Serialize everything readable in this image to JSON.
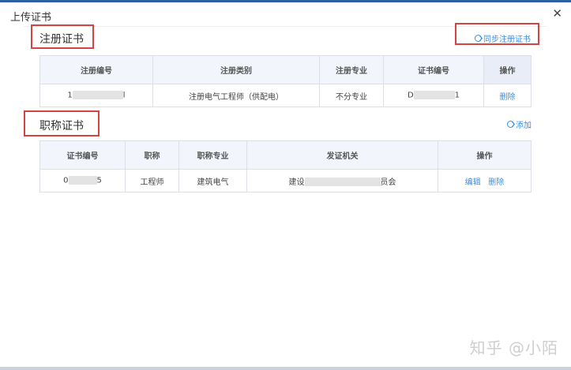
{
  "dialog": {
    "title": "上传证书",
    "close_symbol": "✕"
  },
  "registered": {
    "section_label": "注册证书",
    "sync_link": "同步注册证书",
    "headers": [
      "注册编号",
      "注册类别",
      "注册专业",
      "证书编号",
      "操作"
    ],
    "row": {
      "reg_no_start": "1",
      "reg_no_end": "l",
      "category": "注册电气工程师（供配电）",
      "major": "不分专业",
      "cert_no_start": "D",
      "cert_no_end": "1",
      "delete_label": "删除"
    }
  },
  "title_cert": {
    "section_label": "职称证书",
    "add_link": "添加",
    "headers": [
      "证书编号",
      "职称",
      "职称专业",
      "发证机关",
      "操作"
    ],
    "row": {
      "cert_no_start": "0",
      "cert_no_end": "5",
      "title": "工程师",
      "major": "建筑电气",
      "issuer_start": "建设",
      "issuer_end": "员会",
      "edit_label": "编辑",
      "delete_label": "删除"
    }
  },
  "watermark": "知乎 @小陌",
  "colors": {
    "accent": "#3a8ee6",
    "highlight_box": "#d64343",
    "header_bg": "#f2f6fc",
    "top_bar": "#2b5fa8"
  }
}
